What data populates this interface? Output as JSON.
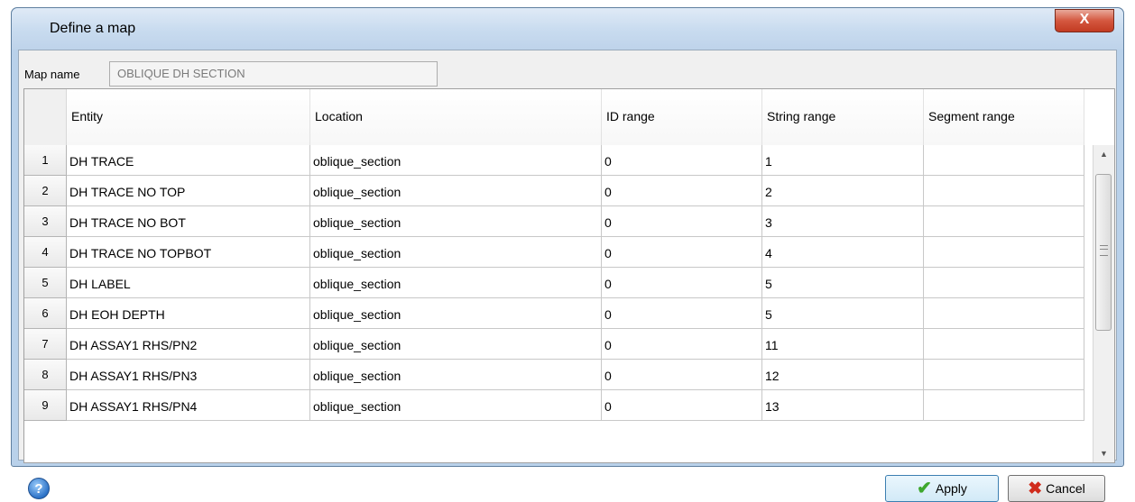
{
  "window": {
    "title": "Define a map",
    "close_glyph": "X"
  },
  "map_name": {
    "label": "Map name",
    "value": "OBLIQUE DH SECTION"
  },
  "grid": {
    "columns": [
      "Entity",
      "Location",
      "ID range",
      "String range",
      "Segment range"
    ],
    "rows": [
      {
        "num": "1",
        "entity": "DH TRACE",
        "location": "oblique_section",
        "id_range": "0",
        "string_range": "1",
        "segment_range": ""
      },
      {
        "num": "2",
        "entity": "DH TRACE NO TOP",
        "location": "oblique_section",
        "id_range": "0",
        "string_range": "2",
        "segment_range": ""
      },
      {
        "num": "3",
        "entity": "DH TRACE NO BOT",
        "location": "oblique_section",
        "id_range": "0",
        "string_range": "3",
        "segment_range": ""
      },
      {
        "num": "4",
        "entity": "DH TRACE NO TOPBOT",
        "location": "oblique_section",
        "id_range": "0",
        "string_range": "4",
        "segment_range": ""
      },
      {
        "num": "5",
        "entity": "DH LABEL",
        "location": "oblique_section",
        "id_range": "0",
        "string_range": "5",
        "segment_range": ""
      },
      {
        "num": "6",
        "entity": "DH EOH DEPTH",
        "location": "oblique_section",
        "id_range": "0",
        "string_range": "5",
        "segment_range": ""
      },
      {
        "num": "7",
        "entity": "DH ASSAY1 RHS/PN2",
        "location": "oblique_section",
        "id_range": "0",
        "string_range": "11",
        "segment_range": ""
      },
      {
        "num": "8",
        "entity": "DH ASSAY1 RHS/PN3",
        "location": "oblique_section",
        "id_range": "0",
        "string_range": "12",
        "segment_range": ""
      },
      {
        "num": "9",
        "entity": "DH ASSAY1 RHS/PN4",
        "location": "oblique_section",
        "id_range": "0",
        "string_range": "13",
        "segment_range": ""
      }
    ]
  },
  "footer": {
    "help_glyph": "?",
    "apply_label": "Apply",
    "cancel_label": "Cancel"
  },
  "colors": {
    "accent": "#3c7fb1",
    "close": "#c23b22"
  }
}
